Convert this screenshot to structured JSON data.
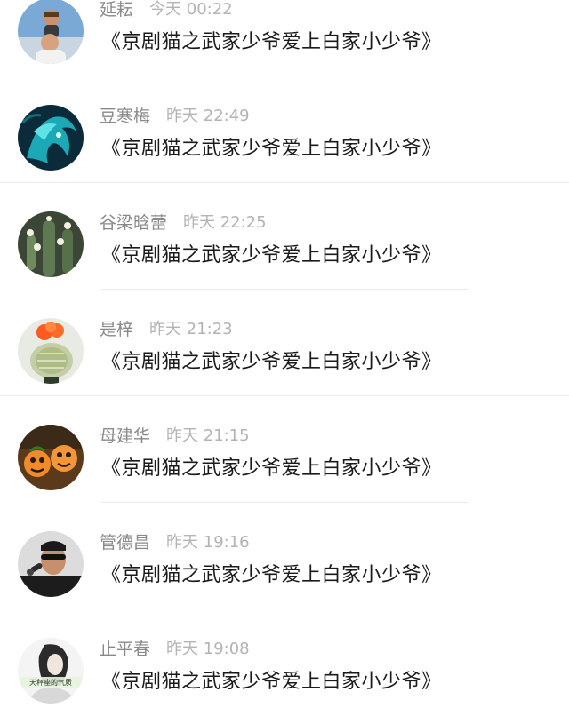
{
  "comments": [
    {
      "name": "延耘",
      "time": "今天 00:22",
      "text": "《京剧猫之武家少爷爱上白家小少爷》",
      "avatar_icon": "man-carrying-child-avatar"
    },
    {
      "name": "豆寒梅",
      "time": "昨天 22:49",
      "text": "《京剧猫之武家少爷爱上白家小少爷》",
      "avatar_icon": "teal-fantasy-creature-avatar"
    },
    {
      "name": "谷梁晗蕾",
      "time": "昨天 22:25",
      "text": "《京剧猫之武家少爷爱上白家小少爷》",
      "avatar_icon": "cactus-flowers-avatar"
    },
    {
      "name": "是梓",
      "time": "昨天 21:23",
      "text": "《京剧猫之武家少爷爱上白家小少爷》",
      "avatar_icon": "flowering-cactus-avatar"
    },
    {
      "name": "母建华",
      "time": "昨天 21:15",
      "text": "《京剧猫之武家少爷爱上白家小少爷》",
      "avatar_icon": "pumpkin-faces-avatar"
    },
    {
      "name": "管德昌",
      "time": "昨天 19:16",
      "text": "《京剧猫之武家少爷爱上白家小少爷》",
      "avatar_icon": "man-with-microphone-avatar"
    },
    {
      "name": "止平春",
      "time": "昨天 19:08",
      "text": "《京剧猫之武家少爷爱上白家小少爷》",
      "avatar_icon": "woman-sketch-avatar",
      "avatar_caption": "天秤座的气质"
    }
  ],
  "colors": {
    "name": "#8a8a8a",
    "time": "#b3b3b3",
    "text": "#1a1a1a",
    "divider": "#ececec"
  }
}
